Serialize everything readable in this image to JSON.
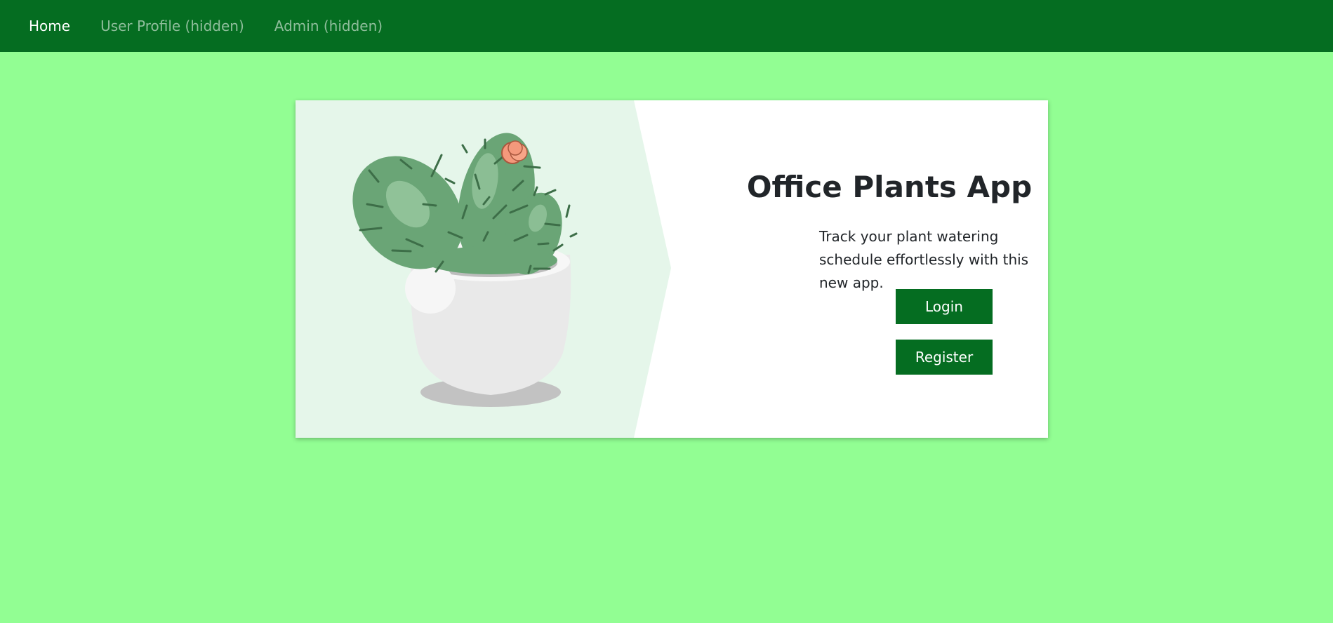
{
  "nav": {
    "items": [
      {
        "label": "Home",
        "active": true
      },
      {
        "label": "User Profile (hidden)",
        "active": false
      },
      {
        "label": "Admin (hidden)",
        "active": false
      }
    ]
  },
  "hero": {
    "illustration": "potted-cactus-illustration",
    "title": "Office Plants App",
    "description": "Track your plant watering schedule effortlessly with this new app.",
    "login_label": "Login",
    "register_label": "Register"
  },
  "colors": {
    "page_background": "#92fe93",
    "navbar": "#056d21",
    "button": "#056d21",
    "illustration_panel": "#e5f6ea"
  }
}
